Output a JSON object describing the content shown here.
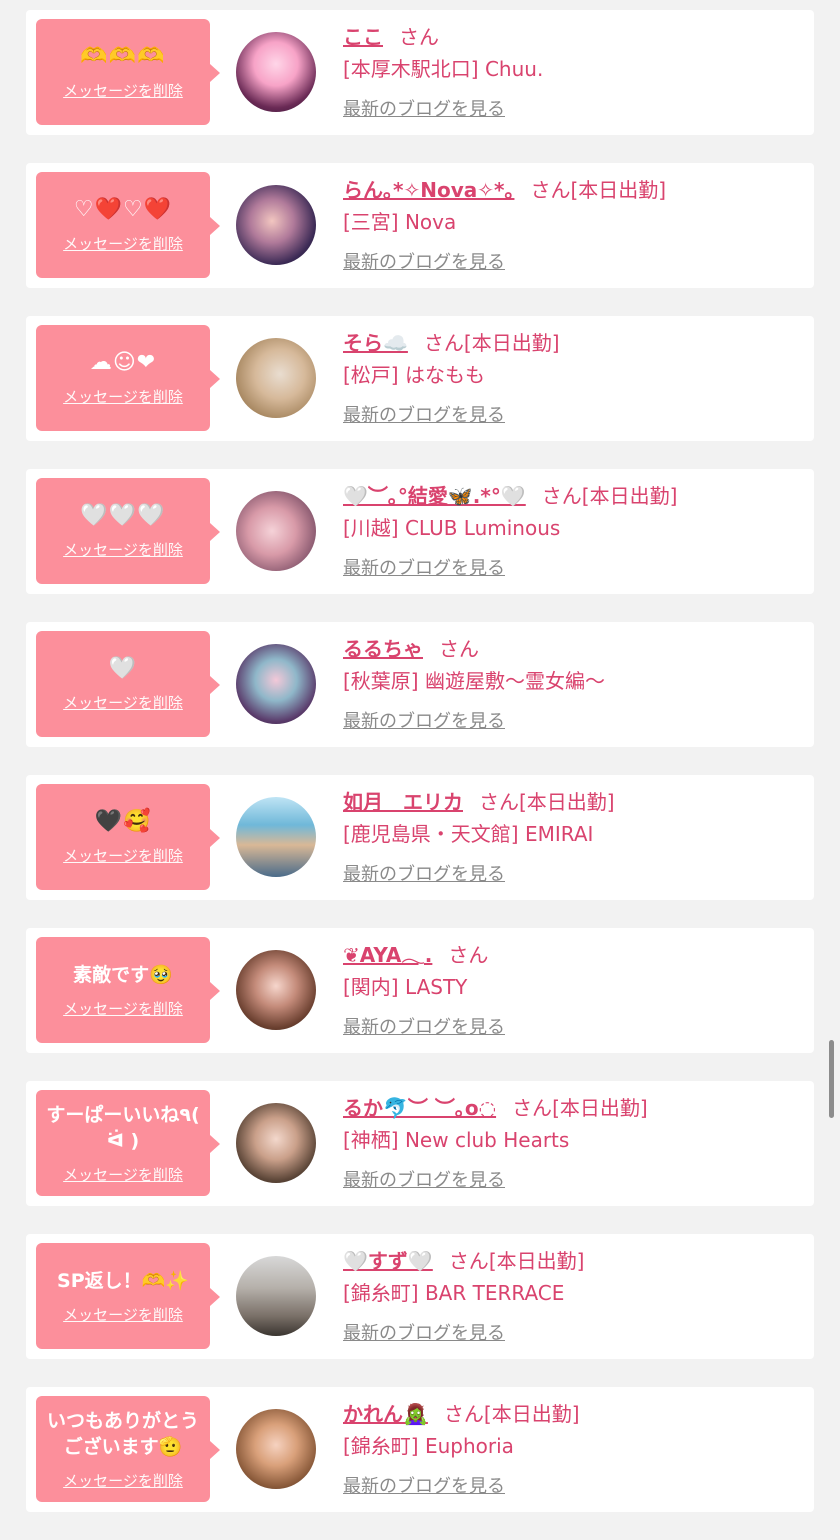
{
  "delete_label": "メッセージを削除",
  "blog_label": "最新のブログを見る",
  "san_label": "さん",
  "accent_color": "#fc8f9b",
  "text_color": "#d9436e",
  "cards": [
    {
      "message": "🫶🫶🫶",
      "name": "ここ",
      "status": "",
      "shop": "[本厚木駅北口] Chuu.",
      "avatar_icon": "avatar-photo"
    },
    {
      "message": "♡❤️♡❤️",
      "name": "らん｡*✧Nova✧*｡",
      "status": "[本日出勤]",
      "shop": "[三宮] Nova",
      "avatar_icon": "avatar-photo"
    },
    {
      "message": "☁︎☺︎❤︎",
      "name": "そら☁️",
      "status": "[本日出勤]",
      "shop": "[松戸] はなもも",
      "avatar_icon": "avatar-photo"
    },
    {
      "message": "🤍🤍🤍",
      "name": "🤍︶｡°結愛🦋.*°🤍",
      "status": "[本日出勤]",
      "shop": "[川越] CLUB Luminous",
      "avatar_icon": "avatar-photo"
    },
    {
      "message": "🤍",
      "name": "るるちゃ",
      "status": "",
      "shop": "[秋葉原] 幽遊屋敷〜霊女編〜",
      "avatar_icon": "avatar-photo"
    },
    {
      "message": "🖤🥰",
      "name": "如月　エリカ",
      "status": "[本日出勤]",
      "shop": "[鹿児島県・天文館] EMIRAI",
      "avatar_icon": "avatar-photo"
    },
    {
      "message": "素敵です🥹",
      "name": "❦AYA𓂃.",
      "status": "",
      "shop": "[関内] LASTY",
      "avatar_icon": "avatar-photo"
    },
    {
      "message": "すーぱーいいね٩( ᐛ )",
      "name": "るか🐬︶ ︶｡o◌",
      "status": "[本日出勤]",
      "shop": "[神栖] New club Hearts",
      "avatar_icon": "avatar-photo"
    },
    {
      "message": "SP返し！🫶✨",
      "name": "🤍すず🤍",
      "status": "[本日出勤]",
      "shop": "[錦糸町] BAR TERRACE",
      "avatar_icon": "avatar-photo"
    },
    {
      "message": "いつもありがとうございます🫡",
      "name": "かれん🧟‍♀️",
      "status": "[本日出勤]",
      "shop": "[錦糸町] Euphoria",
      "avatar_icon": "avatar-photo"
    }
  ]
}
